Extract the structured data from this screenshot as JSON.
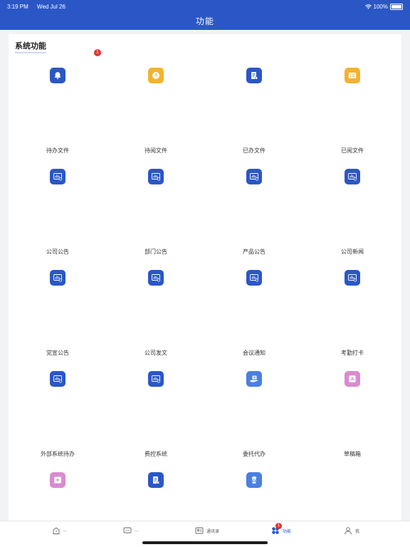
{
  "status": {
    "time": "3:19 PM",
    "date": "Wed Jul 26",
    "battery": "100%"
  },
  "header": {
    "title": "功能"
  },
  "section": {
    "title": "系统功能",
    "badge": "1"
  },
  "items": [
    {
      "label": "待办文件",
      "icon": "bell-icon",
      "color": "#2b57c6"
    },
    {
      "label": "待阅文件",
      "icon": "clock-icon",
      "color": "#f2b32f"
    },
    {
      "label": "已办文件",
      "icon": "document-icon",
      "color": "#2b57c6"
    },
    {
      "label": "已阅文件",
      "icon": "list-card-icon",
      "color": "#f2b32f"
    },
    {
      "label": "公司公告",
      "icon": "chart-icon",
      "color": "#2b57c6"
    },
    {
      "label": "部门公告",
      "icon": "chart-icon",
      "color": "#2b57c6"
    },
    {
      "label": "产品公告",
      "icon": "chart-icon",
      "color": "#2b57c6"
    },
    {
      "label": "公司新闻",
      "icon": "chart-icon",
      "color": "#2b57c6"
    },
    {
      "label": "党宣公告",
      "icon": "chart-icon",
      "color": "#2b57c6"
    },
    {
      "label": "公司发文",
      "icon": "chart-icon",
      "color": "#2b57c6"
    },
    {
      "label": "会议通知",
      "icon": "chart-icon",
      "color": "#2b57c6"
    },
    {
      "label": "考勤打卡",
      "icon": "chart-icon",
      "color": "#2b57c6"
    },
    {
      "label": "外部系统待办",
      "icon": "chart-icon",
      "color": "#2b57c6"
    },
    {
      "label": "费控系统",
      "icon": "chart-icon",
      "color": "#2b57c6"
    },
    {
      "label": "委托代办",
      "icon": "hand-icon",
      "color": "#4a7fe0"
    },
    {
      "label": "草稿箱",
      "icon": "draft-icon",
      "color": "#d98bd1"
    },
    {
      "label": "",
      "icon": "star-card-icon",
      "color": "#d98bd1"
    },
    {
      "label": "",
      "icon": "document-icon",
      "color": "#2b57c6"
    },
    {
      "label": "",
      "icon": "recycle-bin-icon",
      "color": "#4a7fe0"
    }
  ],
  "tabs": [
    {
      "label": "...",
      "icon": "home-icon"
    },
    {
      "label": "...",
      "icon": "message-icon"
    },
    {
      "label": "通讯录",
      "icon": "contacts-icon"
    },
    {
      "label": "功能",
      "icon": "apps-icon",
      "badge": "1"
    },
    {
      "label": "我",
      "icon": "user-icon"
    }
  ]
}
